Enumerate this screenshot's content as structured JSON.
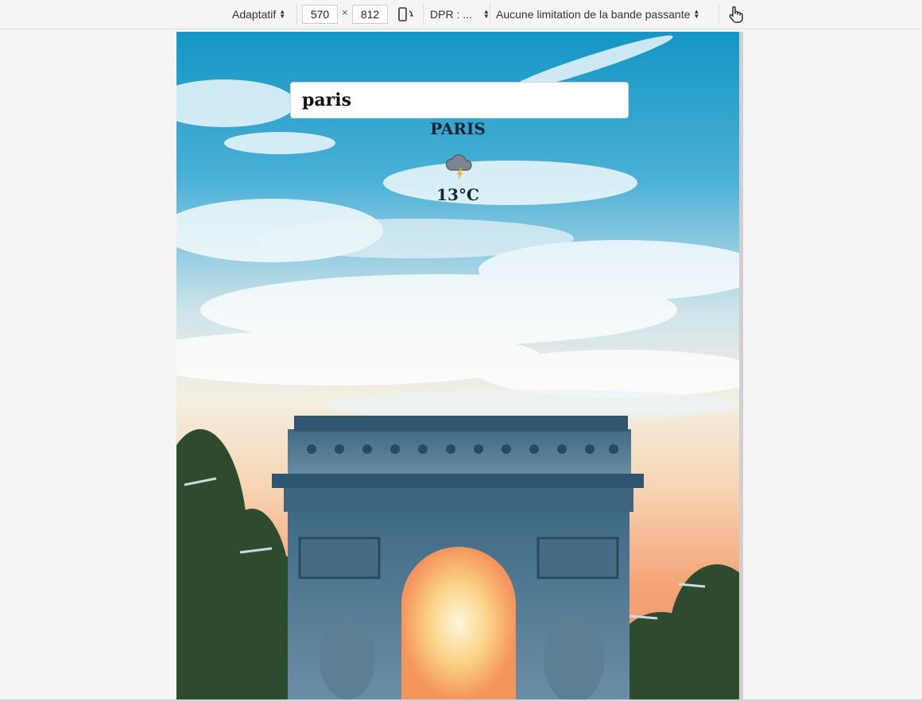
{
  "toolbar": {
    "device_mode": "Adaptatif",
    "width_value": "570",
    "times_symbol": "×",
    "height_value": "812",
    "rotate_icon": "rotate-device-icon",
    "dpr_label": "DPR : ...",
    "throttling_label": "Aucune limitation de la bande passante",
    "touch_icon": "touch-hand-icon"
  },
  "app": {
    "search_value": "paris",
    "city_name": "PARIS",
    "weather_icon": "thunderstorm-cloud-icon",
    "temperature": "13°C",
    "background_image": "arc-de-triomphe-photo"
  },
  "colors": {
    "sky_top": "#1d97c7",
    "sunset": "#f7b57a",
    "monument": "#4d6f86",
    "text": "#1b2430"
  }
}
